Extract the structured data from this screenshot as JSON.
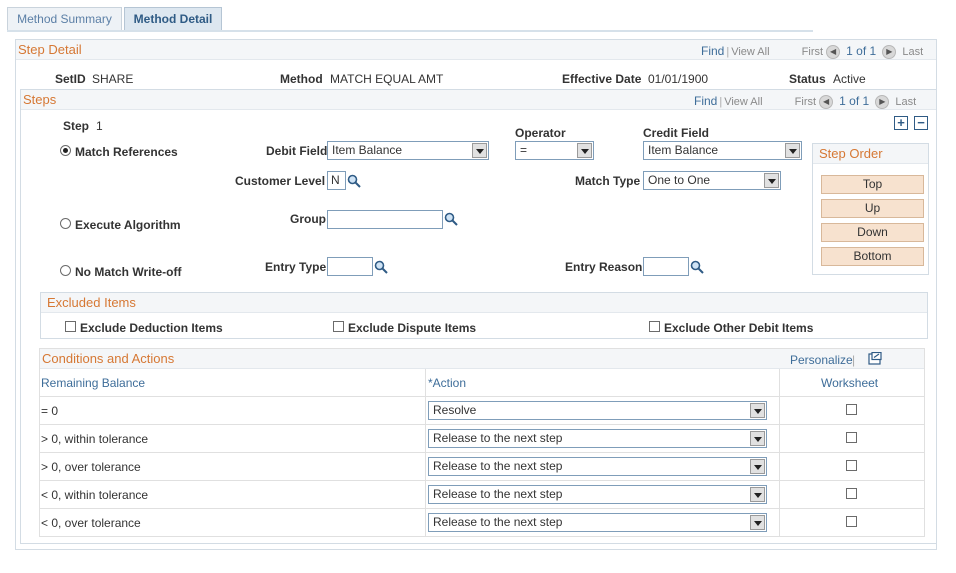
{
  "tabs": [
    {
      "label": "Method Summary"
    },
    {
      "label": "Method Detail"
    }
  ],
  "step_detail": {
    "title": "Step Detail",
    "nav": {
      "find": "Find",
      "view_all": "View All",
      "first": "First",
      "count": "1 of 1",
      "last": "Last"
    },
    "setid_label": "SetID",
    "setid_value": "SHARE",
    "method_label": "Method",
    "method_value": "MATCH EQUAL AMT",
    "effdate_label": "Effective Date",
    "effdate_value": "01/01/1900",
    "status_label": "Status",
    "status_value": "Active"
  },
  "steps": {
    "title": "Steps",
    "nav": {
      "find": "Find",
      "view_all": "View All",
      "first": "First",
      "count": "1 of 1",
      "last": "Last"
    },
    "step_label": "Step",
    "step_value": "1",
    "match_references": "Match References",
    "execute_algorithm": "Execute Algorithm",
    "no_match_writeoff": "No Match Write-off",
    "operator_label": "Operator",
    "credit_field_label": "Credit Field",
    "debit_field_label": "Debit Field",
    "debit_field_value": "Item Balance",
    "operator_value": "=",
    "credit_field_value": "Item Balance",
    "customer_level_label": "Customer Level",
    "customer_level_value": "N",
    "match_type_label": "Match Type",
    "match_type_value": "One to One",
    "group_label": "Group",
    "group_value": "",
    "entry_type_label": "Entry Type",
    "entry_type_value": "",
    "entry_reason_label": "Entry Reason",
    "entry_reason_value": "",
    "add_symbol": "+",
    "remove_symbol": "−"
  },
  "step_order": {
    "title": "Step Order",
    "buttons": [
      "Top",
      "Up",
      "Down",
      "Bottom"
    ]
  },
  "excluded_items": {
    "title": "Excluded Items",
    "deduction": "Exclude Deduction Items",
    "dispute": "Exclude Dispute Items",
    "other_debit": "Exclude Other Debit Items"
  },
  "conditions": {
    "title": "Conditions and Actions",
    "personalize": "Personalize",
    "col_remaining": "Remaining Balance",
    "col_action": "*Action",
    "col_worksheet": "Worksheet",
    "rows": [
      {
        "balance": "= 0",
        "action": "Resolve"
      },
      {
        "balance": "> 0, within tolerance",
        "action": "Release to the next step"
      },
      {
        "balance": "> 0, over tolerance",
        "action": "Release to the next step"
      },
      {
        "balance": "< 0, within tolerance",
        "action": "Release to the next step"
      },
      {
        "balance": "< 0, over tolerance",
        "action": "Release to the next step"
      }
    ]
  },
  "colors": {
    "accent": "#d67834",
    "link": "#3e6d99",
    "button": "#f7e2cf"
  }
}
